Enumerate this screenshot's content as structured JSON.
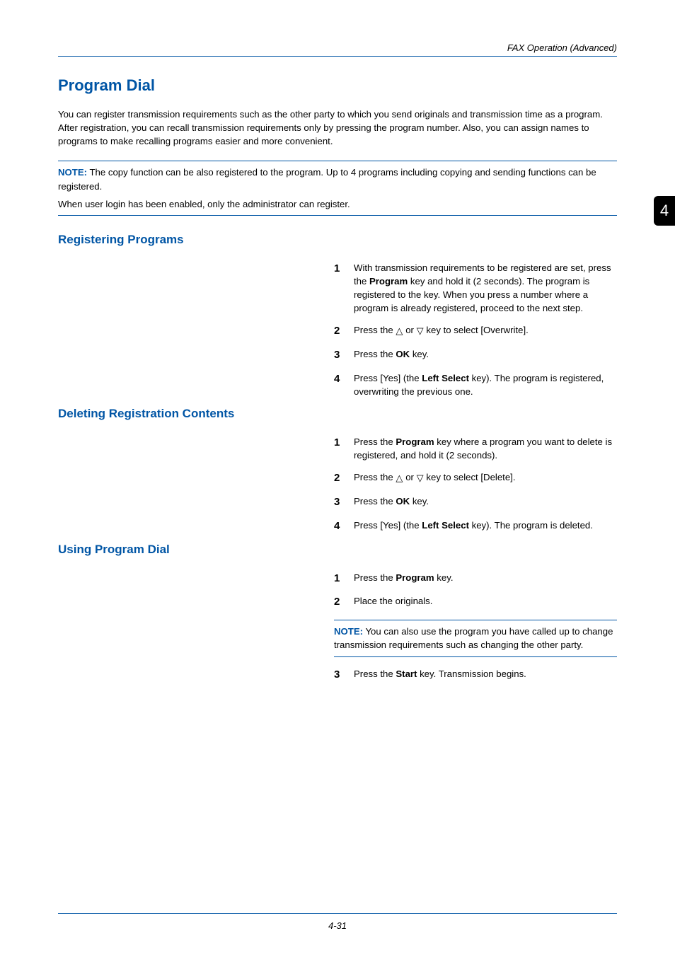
{
  "header": {
    "section_title": "FAX Operation (Advanced)"
  },
  "chapter_tab": "4",
  "h1": "Program Dial",
  "intro": "You can register transmission requirements such as the other party to which you send originals and transmission time as a program. After registration, you can recall transmission requirements only by pressing the program number. Also, you can assign names to programs to make recalling programs easier and more convenient.",
  "note_label": "NOTE:",
  "top_note_line1": " The copy function can be also registered to the program. Up to 4 programs including copying and sending functions can be registered.",
  "top_note_line2": "When user login has been enabled, only the administrator can register.",
  "sections": {
    "registering": {
      "title": "Registering Programs",
      "steps": {
        "s1": {
          "num": "1",
          "pre": "With transmission requirements to be registered are set, press the ",
          "bold1": "Program",
          "post": " key and hold it (2 seconds). The program is registered to the key. When you press a number where a program is already registered, proceed to the next step."
        },
        "s2": {
          "num": "2",
          "pre": "Press the ",
          "mid": " or ",
          "post": " key to select [Overwrite]."
        },
        "s3": {
          "num": "3",
          "pre": "Press the ",
          "bold1": "OK",
          "post": " key."
        },
        "s4": {
          "num": "4",
          "pre": "Press [Yes] (the ",
          "bold1": "Left Select",
          "post": " key). The program is registered, overwriting the previous one."
        }
      }
    },
    "deleting": {
      "title": "Deleting Registration Contents",
      "steps": {
        "s1": {
          "num": "1",
          "pre": "Press the ",
          "bold1": "Program",
          "post": " key where a program you want to delete is registered, and hold it (2 seconds)."
        },
        "s2": {
          "num": "2",
          "pre": "Press the ",
          "mid": " or ",
          "post": " key to select [Delete]."
        },
        "s3": {
          "num": "3",
          "pre": "Press the ",
          "bold1": "OK",
          "post": " key."
        },
        "s4": {
          "num": "4",
          "pre": "Press [Yes] (the ",
          "bold1": "Left Select",
          "post": " key). The program is deleted."
        }
      }
    },
    "using": {
      "title": "Using Program Dial",
      "steps": {
        "s1": {
          "num": "1",
          "pre": "Press the ",
          "bold1": "Program",
          "post": " key."
        },
        "s2": {
          "num": "2",
          "text": "Place the originals."
        },
        "s3": {
          "num": "3",
          "pre": "Press the ",
          "bold1": "Start",
          "post": " key. Transmission begins."
        }
      },
      "note": " You can also use the program you have called up to change transmission requirements such as changing the other party."
    }
  },
  "footer_page": "4-31"
}
